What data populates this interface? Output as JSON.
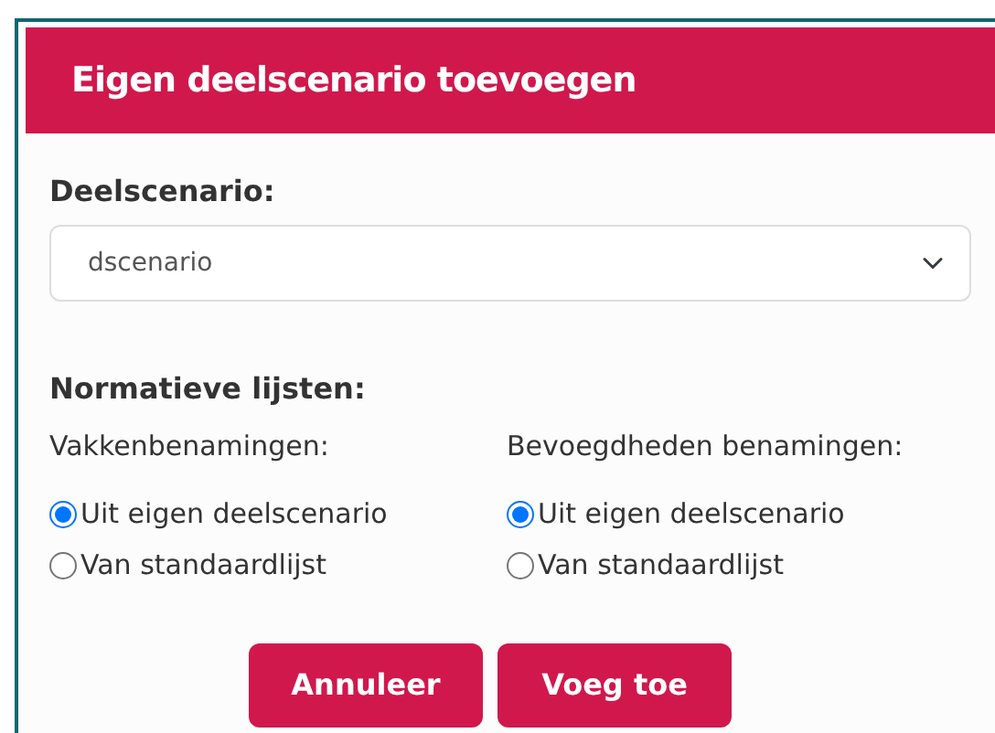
{
  "dialog": {
    "title": "Eigen deelscenario toevoegen",
    "field": {
      "label": "Deelscenario:",
      "value": "dscenario"
    },
    "section_title": "Normatieve lijsten:",
    "groups": [
      {
        "label": "Vakkenbenamingen:",
        "options": [
          {
            "label": "Uit eigen deelscenario",
            "selected": true
          },
          {
            "label": "Van standaardlijst",
            "selected": false
          }
        ]
      },
      {
        "label": "Bevoegdheden benamingen:",
        "options": [
          {
            "label": "Uit eigen deelscenario",
            "selected": true
          },
          {
            "label": "Van standaardlijst",
            "selected": false
          }
        ]
      }
    ],
    "buttons": [
      "Annuleer",
      "Voeg toe"
    ]
  }
}
